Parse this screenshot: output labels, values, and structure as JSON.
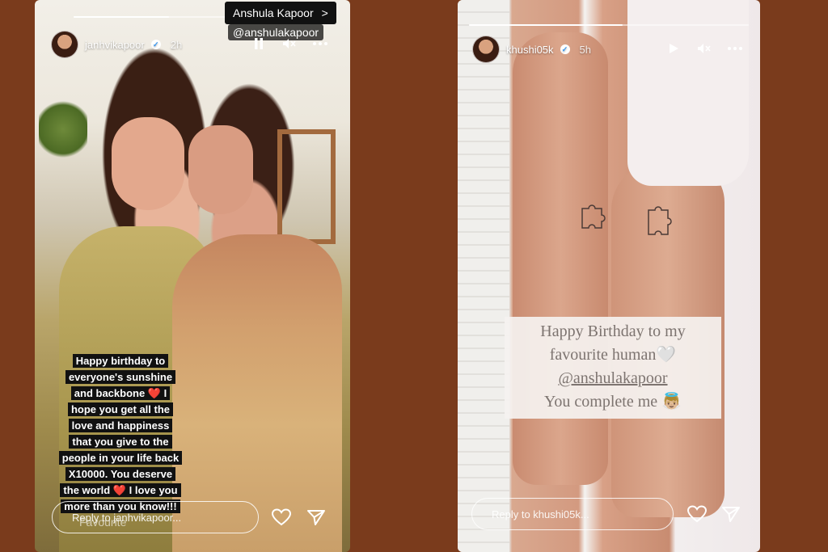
{
  "story1": {
    "progress": 0.5,
    "username": "janhvikapoor",
    "time": "2h",
    "mention_tag": {
      "name": "Anshula Kapoor",
      "chevron": ">",
      "handle": "@anshulakapoor"
    },
    "caption_lines": [
      "Happy birthday to",
      "everyone's sunshine",
      "and backbone ❤️ I",
      "hope you get all the",
      "love and happiness",
      "that you give to the",
      "people in your life back",
      "X10000. You deserve",
      "the world ❤️ I love you",
      "more than you know!!!"
    ],
    "sticker": "Favourite",
    "reply_placeholder": "Reply to janhvikapoor...",
    "icons": {
      "pause": "pause-icon",
      "mute": "mute-icon",
      "more": "more-icon",
      "like": "heart-icon",
      "share": "send-icon"
    }
  },
  "story2": {
    "progress": 0.55,
    "username": "khushi05k",
    "time": "5h",
    "caption": {
      "line1": "Happy Birthday to my",
      "line2": "favourite human🤍",
      "mention": "@anshulakapoor",
      "line4": "You complete me 👼🏼"
    },
    "reply_placeholder": "Reply to khushi05k...",
    "icons": {
      "play": "play-icon",
      "mute": "mute-icon",
      "more": "more-icon",
      "like": "heart-icon",
      "share": "send-icon"
    }
  },
  "colors": {
    "background": "#7a3b1c",
    "verified": "#3897f0"
  }
}
